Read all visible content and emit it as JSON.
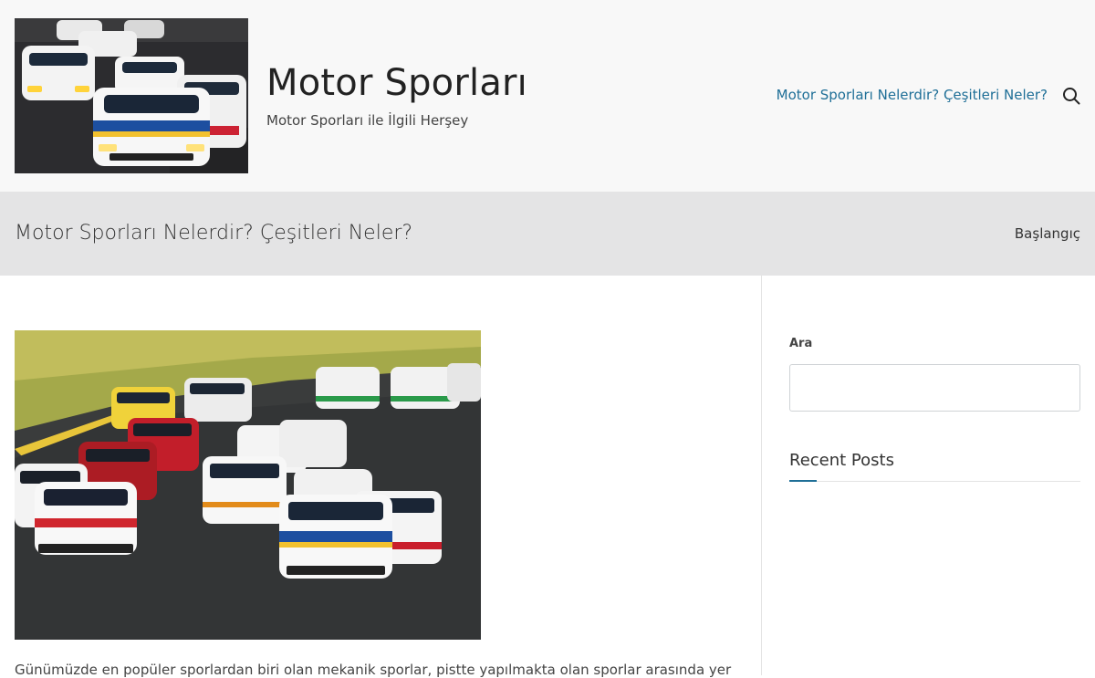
{
  "site": {
    "title": "Motor Sporları",
    "tagline": "Motor Sporları ile İlgili Herşey",
    "logo_alt": "race cars on track"
  },
  "nav": {
    "link_label": "Motor Sporları Nelerdir? Çeşitleri Neler?",
    "search_icon": "search-icon"
  },
  "page": {
    "title": "Motor Sporları Nelerdir? Çeşitleri Neler?",
    "breadcrumb": "Başlangıç"
  },
  "post": {
    "image_alt": "touring cars racing on circuit",
    "excerpt": "Günümüzde en popüler sporlardan biri olan mekanik sporlar, pistte yapılmakta olan sporlar arasında yer"
  },
  "sidebar": {
    "search_label": "Ara",
    "search_value": "",
    "recent_posts_title": "Recent Posts"
  },
  "colors": {
    "accent": "#1f6f97",
    "header_bg": "#f8f8f8",
    "title_bar_bg": "#e4e4e5"
  }
}
